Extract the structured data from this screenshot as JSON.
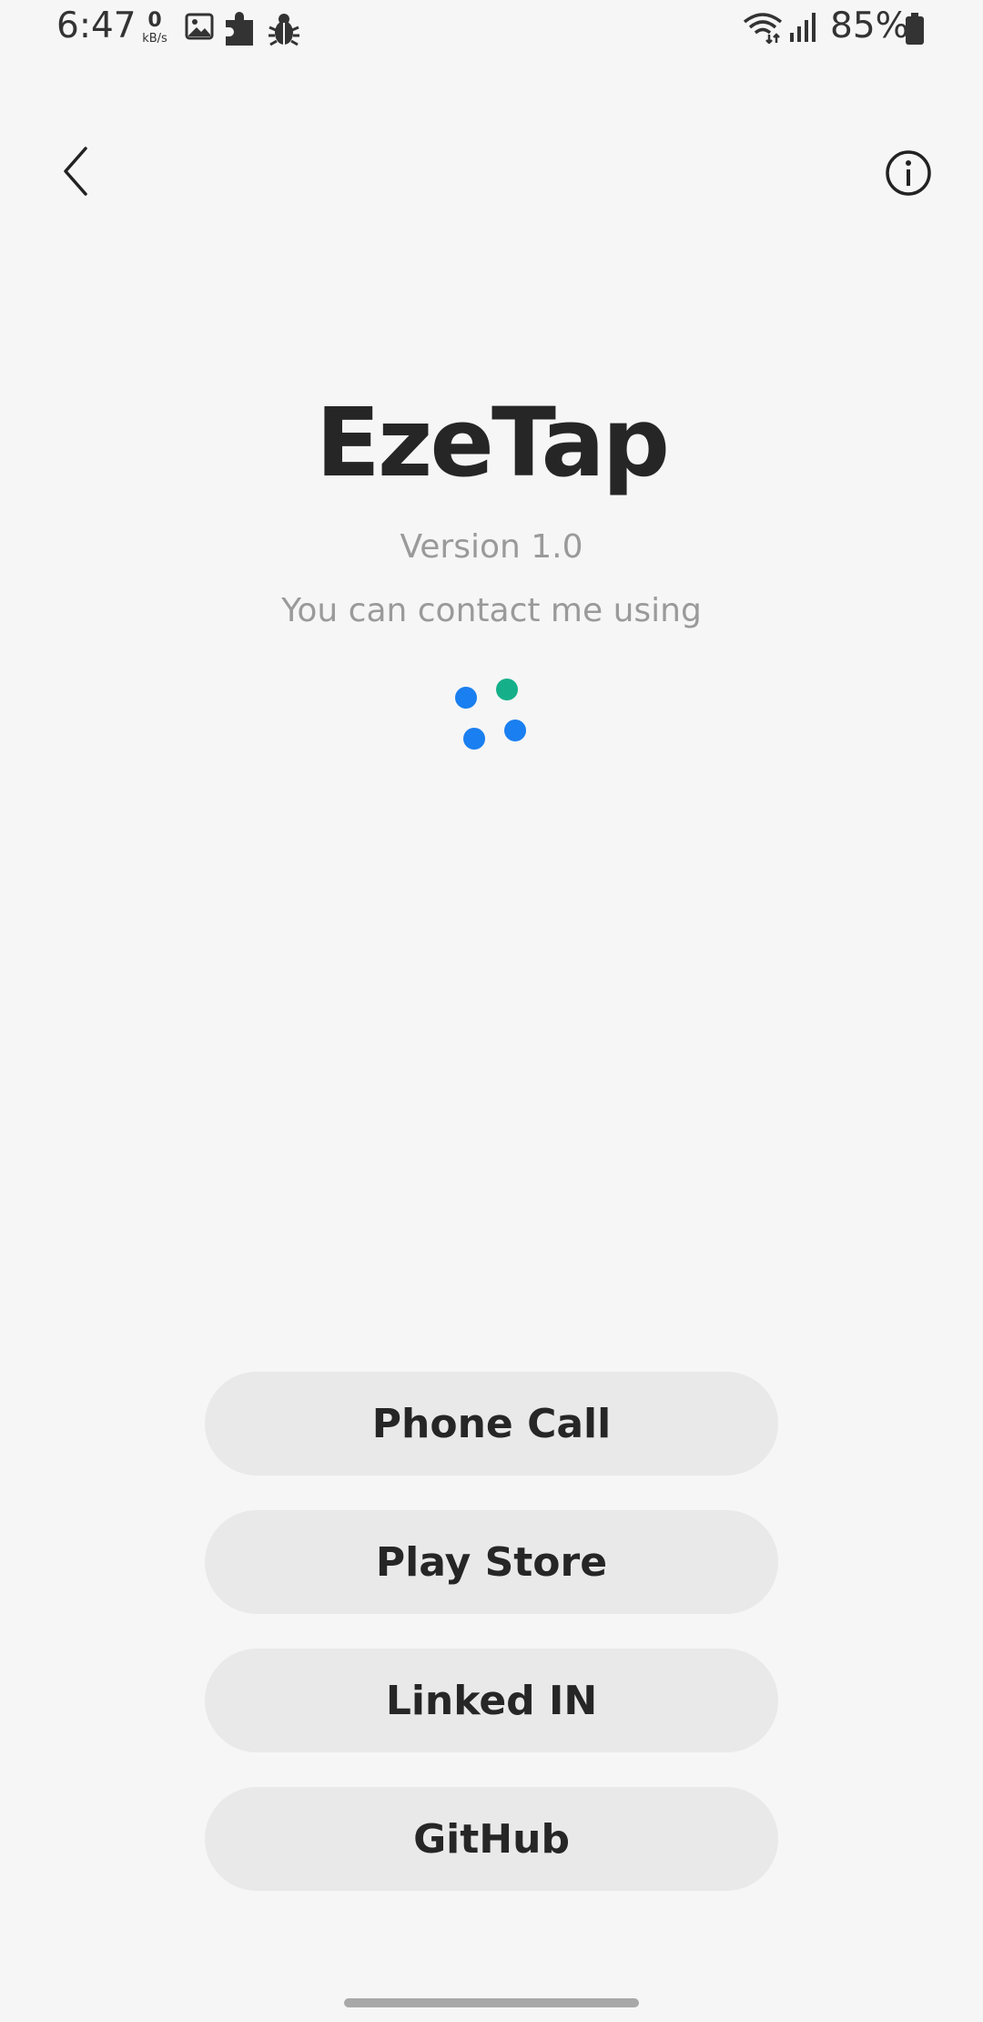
{
  "status_bar": {
    "time": "6:47",
    "net_speed_value": "0",
    "net_speed_unit": "kB/s",
    "battery_percent": "85%",
    "icons": [
      "image-icon",
      "puzzle-icon",
      "bug-icon",
      "wifi-icon",
      "signal-icon",
      "battery-icon"
    ]
  },
  "app_bar": {
    "back_icon": "chevron-left-icon",
    "info_icon": "info-circle-icon"
  },
  "header": {
    "title": "EzeTap",
    "version": "Version 1.0",
    "subtitle": "You can contact me using"
  },
  "loader": {
    "colors": [
      "#1a7ff0",
      "#15b08a",
      "#1a7ff0",
      "#1a7ff0"
    ]
  },
  "buttons": [
    {
      "label": "Phone Call"
    },
    {
      "label": "Play Store"
    },
    {
      "label": "Linked IN"
    },
    {
      "label": "GitHub"
    }
  ],
  "colors": {
    "background": "#f6f6f6",
    "button_bg": "#e9e9e9",
    "primary_text": "#262626",
    "secondary_text": "#9a9a9a"
  }
}
